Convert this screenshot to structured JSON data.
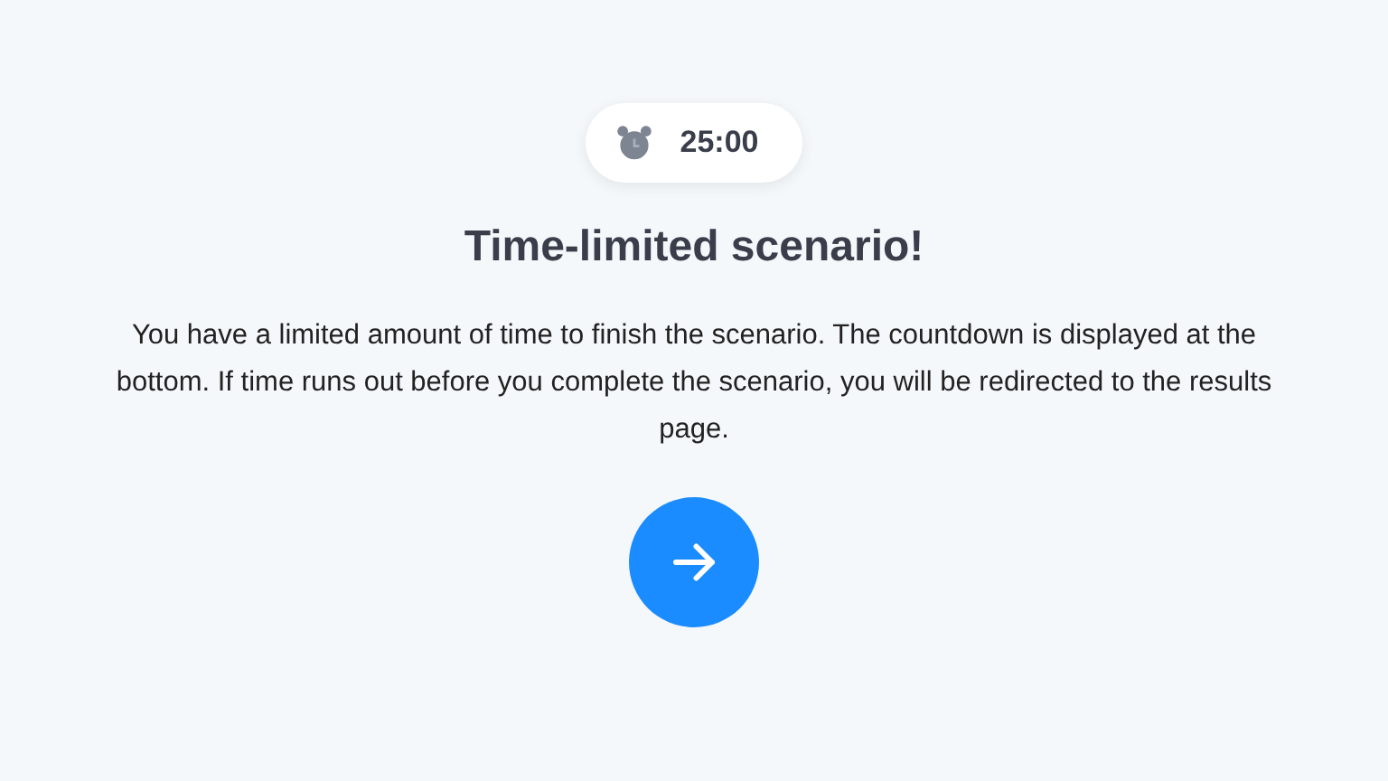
{
  "timer": {
    "time": "25:00"
  },
  "title": "Time-limited scenario!",
  "description": "You have a limited amount of time to finish the scenario. The countdown is displayed at the bottom. If time runs out before you complete the scenario, you will be redirected to the results page."
}
